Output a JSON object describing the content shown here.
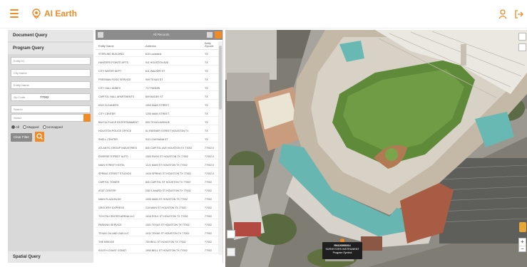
{
  "header": {
    "title": "AI Earth",
    "accent": "#f08a24"
  },
  "icons": {
    "menu": "hamburger-icon",
    "logo": "globe-pin-icon",
    "user": "user-icon",
    "logout": "logout-icon"
  },
  "left_panel": {
    "document_query": "Document Query",
    "program_query": "Program Query",
    "spatial_query": "Spatial Query",
    "fields": [
      {
        "label": "Entity ID",
        "value": ""
      },
      {
        "label": "City Name",
        "value": ""
      },
      {
        "label": "Entity Name",
        "value": ""
      },
      {
        "label": "Zip Code",
        "value": "77002"
      },
      {
        "label": "Search",
        "value": ""
      }
    ],
    "select_placeholder": "Select",
    "radios": {
      "all": "All",
      "mapped": "Mapped",
      "unmapped": "Unmapped"
    },
    "clear_button": "Clear Filter"
  },
  "results": {
    "title": "All Records",
    "columns": {
      "name": "Entity Name",
      "address": "Address",
      "zip": "Entity Zipcode"
    },
    "rows": [
      {
        "name": "STERLING BUILDING",
        "address": "615 Louisiana",
        "zip": "TX"
      },
      {
        "name": "HUNTERS POINTE APTS",
        "address": "911 HOUSTON AVE",
        "zip": "TX"
      },
      {
        "name": "CITY WATER DEPT",
        "address": "611 WALKER ST",
        "zip": "TX"
      },
      {
        "name": "FREEMAN FOOD SERVICE",
        "address": "909 TEXAS ST",
        "zip": "TX"
      },
      {
        "name": "CITY HALL ANNEX",
        "address": "717 FANNIN",
        "zip": "TX"
      },
      {
        "name": "CAPITOL HALL APARTMENTS",
        "address": "609 BAGBY ST",
        "zip": "TX"
      },
      {
        "name": "KIWI CLEANERS",
        "address": "1000 MAIN STREET",
        "zip": "TX"
      },
      {
        "name": "CITY CENTER",
        "address": "1200 MAIN STREET",
        "zip": "TX"
      },
      {
        "name": "BAYOU PLACE ENTERTAINMENT",
        "address": "500 TEXAS AVENUE",
        "zip": "TX"
      },
      {
        "name": "HOUSTON POLICE OFFICE",
        "address": "61 RIESNER STREET HOUSTON TX",
        "zip": "TX"
      },
      {
        "name": "SHELL CENTER",
        "address": "910 LOUISIANA ST",
        "zip": "TX"
      },
      {
        "name": "ATLANTIC GROUP INDUSTRIES",
        "address": "800 CAPITOL AVE HOUSTON TX 77002",
        "zip": "77002.0"
      },
      {
        "name": "DIVERSE STREET AUTO",
        "address": "1000 RUSK ST HOUSTON TX 77002",
        "zip": "77002.0"
      },
      {
        "name": "MAIN STREET HOTEL",
        "address": "1121 MAIN ST HOUSTON TX 77002",
        "zip": "77002.0"
      },
      {
        "name": "SPRING STREET STUDIOS",
        "address": "1919 SPRING ST HOUSTON TX 77002",
        "zip": "77002.0"
      },
      {
        "name": "CAPITOL TOWER",
        "address": "800 CAPITOL ST HOUSTON TX 77002",
        "zip": "77002"
      },
      {
        "name": "AT&T CENTER",
        "address": "208 S AKARD ST HOUSTON TX 77002",
        "zip": "77002"
      },
      {
        "name": "MAIN PLAZA BLDG",
        "address": "1000 MAIN ST HOUSTON TX 77002",
        "zip": "77002"
      },
      {
        "name": "GROCERY EXPRESS",
        "address": "215 MAIN ST HOUSTON TX 77002",
        "zip": "77002"
      },
      {
        "name": "TOYOTA CENTER ARENA LLC",
        "address": "1510 POLK ST HOUSTON TX 77002",
        "zip": "77002"
      },
      {
        "name": "PARKING SERVICE",
        "address": "1001 TEXAS ST HOUSTON TX 77002",
        "zip": "77002"
      },
      {
        "name": "TEXAS OIL AND GAS LLC",
        "address": "1011 TEXAS ST HOUSTON TX 77002",
        "zip": "77002"
      },
      {
        "name": "THE BRIDGE",
        "address": "700 BELL ST HOUSTON TX 77002",
        "zip": "77002"
      },
      {
        "name": "SOUTH COAST CONST",
        "address": "1900 BELL ST HOUSTON TX 77002",
        "zip": "77002"
      }
    ]
  },
  "map": {
    "popup": {
      "line1": "RN100956914",
      "line2": "SURVEYORS INSTRUMENT",
      "line3": "Program Symbol"
    }
  }
}
